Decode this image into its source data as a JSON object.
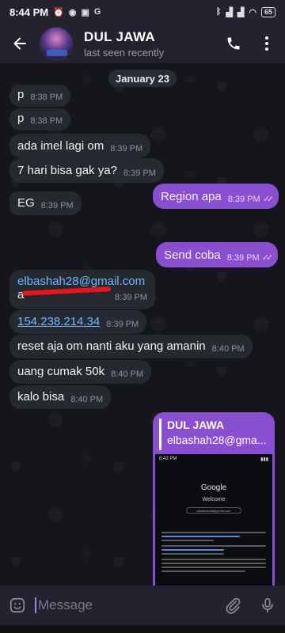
{
  "status_bar": {
    "time": "8:44 PM",
    "battery": "65"
  },
  "header": {
    "name": "DUL JAWA",
    "status": "last seen recently"
  },
  "chat": {
    "date": "January 23",
    "messages": [
      {
        "dir": "in",
        "text": "p",
        "time": "8:38 PM"
      },
      {
        "dir": "in",
        "text": "p",
        "time": "8:38 PM"
      },
      {
        "dir": "in",
        "text": "ada imel lagi om",
        "time": "8:39 PM"
      },
      {
        "dir": "in",
        "text": "7 hari bisa gak ya?",
        "time": "8:39 PM"
      },
      {
        "dir": "out",
        "text": "Region apa",
        "time": "8:39 PM"
      },
      {
        "dir": "in",
        "text": "EG",
        "time": "8:39 PM"
      },
      {
        "dir": "out",
        "text": "Send coba",
        "time": "8:39 PM"
      },
      {
        "dir": "in",
        "text": "elbashah28@gmail.com",
        "text2": "a",
        "time": "8:39 PM"
      },
      {
        "dir": "in",
        "text": "154.238.214.34",
        "time": "8:39 PM"
      },
      {
        "dir": "in",
        "text": "reset aja om nanti aku yang amanin",
        "time": "8:40 PM"
      },
      {
        "dir": "in",
        "text": "uang cumak 50k",
        "time": "8:40 PM"
      },
      {
        "dir": "in",
        "text": "kalo bisa",
        "time": "8:40 PM"
      }
    ],
    "reply": {
      "name": "DUL JAWA",
      "text": "elbashah28@gma..."
    },
    "screenshot": {
      "time": "8:42 PM",
      "title": "Google",
      "subtitle": "Welcome",
      "email": "elbashah28@gmail.com"
    }
  },
  "composer": {
    "placeholder": "Message"
  },
  "colors": {
    "accent": "#8a4fd0",
    "incoming": "#272930",
    "header": "#23222e",
    "link": "#6fb7ff"
  }
}
